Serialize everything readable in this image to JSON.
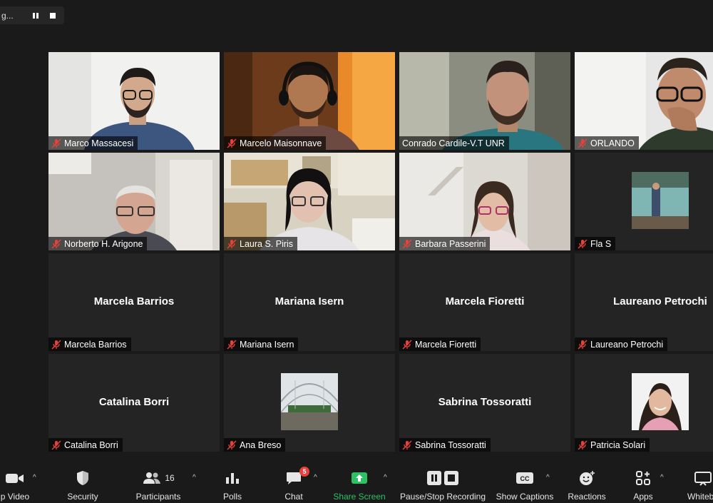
{
  "recording": {
    "status_text": "g..."
  },
  "tiles": [
    {
      "name": "Marco Massacesi",
      "kind": "video",
      "muted": true
    },
    {
      "name": "Marcelo Maisonnave",
      "kind": "video",
      "muted": true
    },
    {
      "name": "Conrado Cardile-V.T UNR",
      "kind": "video",
      "muted": false,
      "active_speaker": true
    },
    {
      "name": "ORLANDO",
      "kind": "video",
      "muted": true
    },
    {
      "name": "Norberto H. Arigone",
      "kind": "video",
      "muted": true
    },
    {
      "name": "Laura S. Piris",
      "kind": "video",
      "muted": true
    },
    {
      "name": "Barbara Passerini",
      "kind": "video",
      "muted": true
    },
    {
      "name": "Fla S",
      "kind": "photo",
      "muted": true
    },
    {
      "name": "Marcela Barrios",
      "kind": "name",
      "display_name": "Marcela Barrios",
      "muted": true
    },
    {
      "name": "Mariana Isern",
      "kind": "name",
      "display_name": "Mariana Isern",
      "muted": true
    },
    {
      "name": "Marcela Fioretti",
      "kind": "name",
      "display_name": "Marcela Fioretti",
      "muted": true
    },
    {
      "name": "Laureano Petrochi",
      "kind": "name",
      "display_name": "Laureano Petrochi",
      "muted": true
    },
    {
      "name": "Catalina Borri",
      "kind": "name",
      "display_name": "Catalina Borri",
      "muted": true
    },
    {
      "name": "Ana Breso",
      "kind": "photo",
      "muted": true
    },
    {
      "name": "Sabrina Tossoratti",
      "kind": "name",
      "display_name": "Sabrina Tossoratti",
      "muted": true
    },
    {
      "name": "Patricia Solari",
      "kind": "photo",
      "muted": true
    }
  ],
  "toolbar": {
    "video_label": "p Video",
    "security_label": "Security",
    "participants_label": "Participants",
    "participants_count": "16",
    "polls_label": "Polls",
    "chat_label": "Chat",
    "chat_badge": "5",
    "share_label": "Share Screen",
    "recording_label": "Pause/Stop Recording",
    "captions_label": "Show Captions",
    "captions_icon_text": "CC",
    "reactions_label": "Reactions",
    "apps_label": "Apps",
    "whiteboard_label": "Whitebo"
  },
  "icons": {
    "video": "video-camera-icon",
    "security": "shield-icon",
    "participants": "people-icon",
    "polls": "bar-chart-icon",
    "chat": "chat-bubble-icon",
    "share": "share-up-arrow-icon",
    "recording": "pause-stop-icon",
    "captions": "cc-icon",
    "reactions": "emoji-plus-icon",
    "apps": "apps-icon",
    "whiteboard": "whiteboard-icon"
  },
  "colors": {
    "background": "#1a1a1a",
    "tile": "#242424",
    "active_speaker_border": "#c9df86",
    "muted_red": "#e8403a",
    "share_green": "#2ec163"
  }
}
